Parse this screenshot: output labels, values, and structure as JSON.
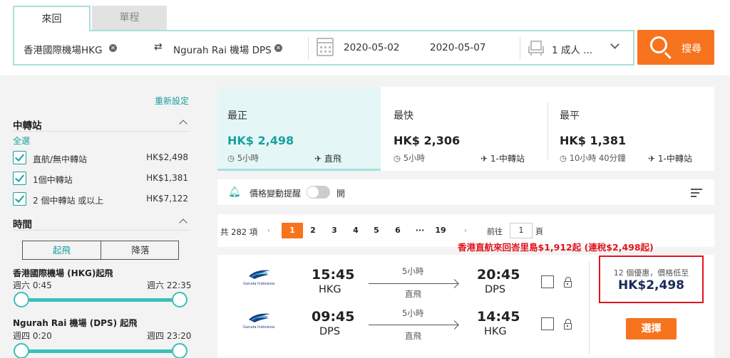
{
  "tabs": {
    "round_trip": "來回",
    "one_way": "單程"
  },
  "search": {
    "origin": "香港國際機場HKG",
    "destination": "Ngurah Rai 機場 DPS",
    "depart_date": "2020-05-02",
    "return_date": "2020-05-07",
    "passengers": "1 成人 ...",
    "search_label": "搜尋"
  },
  "sidebar": {
    "reset": "重新設定",
    "stops": {
      "title": "中轉站",
      "select_all": "全選",
      "options": [
        {
          "label": "直航/無中轉站",
          "price": "HK$2,498",
          "checked": true
        },
        {
          "label": "1個中轉站",
          "price": "HK$1,381",
          "checked": true
        },
        {
          "label": "2 個中轉站 或以上",
          "price": "HK$7,122",
          "checked": true
        }
      ]
    },
    "time": {
      "title": "時間",
      "seg_takeoff": "起飛",
      "seg_landing": "降落",
      "ranges": [
        {
          "title": "香港國際機場 (HKG)起飛",
          "from": "週六 0:45",
          "to": "週六 22:35"
        },
        {
          "title": "Ngurah Rai 機場 (DPS) 起飛",
          "from": "週四 0:20",
          "to": "週四 23:20"
        }
      ]
    }
  },
  "summary": [
    {
      "title": "最正",
      "price": "HK$ 2,498",
      "duration": "5小時",
      "stops": "直飛",
      "selected": true
    },
    {
      "title": "最快",
      "price": "HK$ 2,306",
      "duration": "5小時",
      "stops": "1-中轉站",
      "selected": false
    },
    {
      "title": "最平",
      "price": "HK$ 1,381",
      "duration": "10小時 40分鐘",
      "stops": "1-中轉站",
      "selected": false
    }
  ],
  "alert": {
    "label": "價格變動提醒",
    "state": "開"
  },
  "pagination": {
    "total": "共 282 項",
    "pages": [
      "1",
      "2",
      "3",
      "4",
      "5",
      "6",
      "···",
      "19"
    ],
    "current": "1",
    "goto_prefix": "前往",
    "goto_value": "1",
    "goto_suffix": "頁"
  },
  "promo": "香港直航來回峇里島$1,912起 (連稅$2,498起)",
  "result": {
    "airline_caption": "Garuda Indonesia",
    "outbound": {
      "dep_time": "15:45",
      "dep_code": "HKG",
      "duration": "5小時",
      "type": "直飛",
      "arr_time": "20:45",
      "arr_code": "DPS"
    },
    "inbound": {
      "dep_time": "09:45",
      "dep_code": "DPS",
      "duration": "5小時",
      "type": "直飛",
      "arr_time": "14:45",
      "arr_code": "HKG"
    },
    "deals": "12 個優惠，價格低至",
    "price": "HK$2,498",
    "select_label": "選擇"
  },
  "colors": {
    "accent": "#1a9fa0",
    "orange": "#f7731e",
    "highlight": "#e0141e",
    "teal_border": "#a8e0dc"
  }
}
